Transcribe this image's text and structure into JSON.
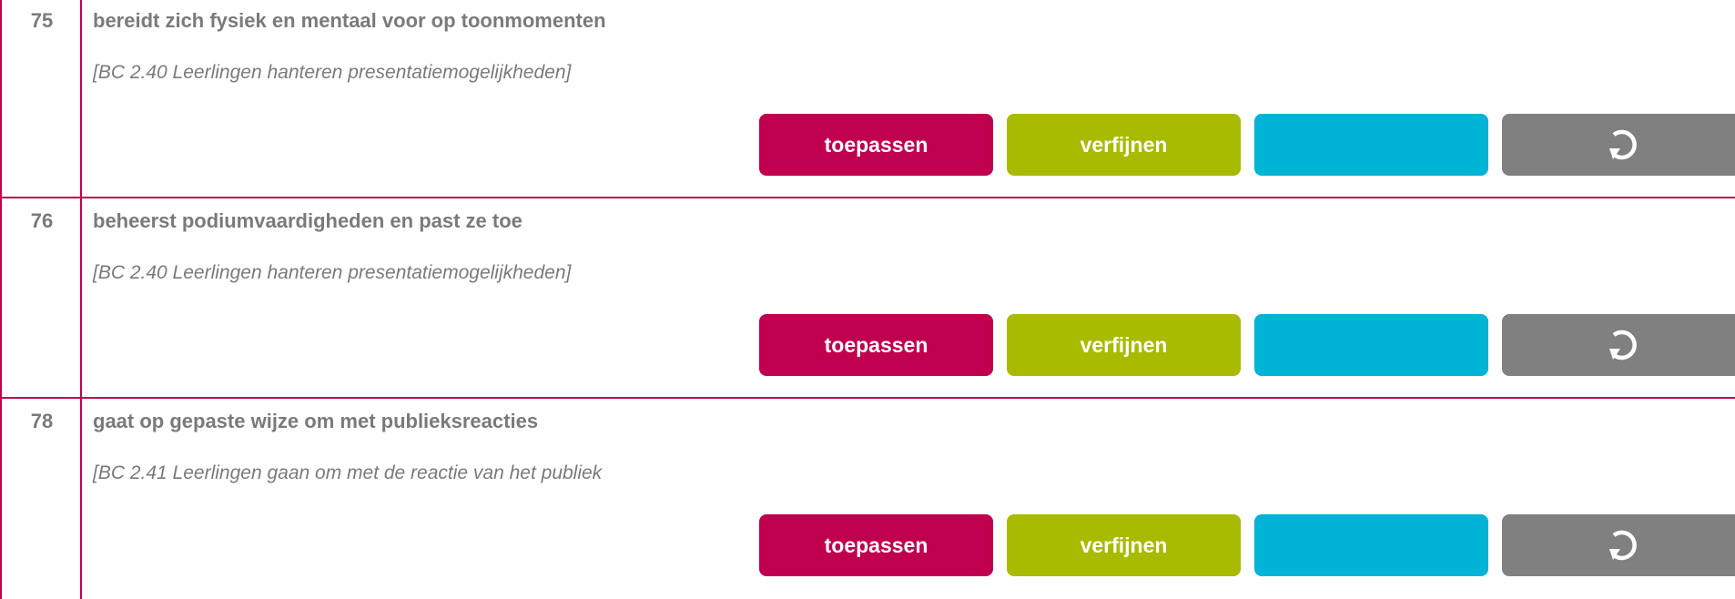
{
  "colors": {
    "border": "#c0004e",
    "apply": "#c0004e",
    "refine": "#a8bb00",
    "blank": "#00b4d6",
    "reset": "#808080",
    "text": "#7a7a7a"
  },
  "rows": [
    {
      "number": "75",
      "title": "bereidt zich fysiek en mentaal voor op toonmomenten",
      "reference": "[BC 2.40 Leerlingen hanteren presentatiemogelijkheden]",
      "apply_label": "toepassen",
      "refine_label": "verfijnen",
      "reset_icon": "refresh-icon"
    },
    {
      "number": "76",
      "title": "beheerst podiumvaardigheden en past ze toe",
      "reference": "[BC 2.40 Leerlingen hanteren presentatiemogelijkheden]",
      "apply_label": "toepassen",
      "refine_label": "verfijnen",
      "reset_icon": "refresh-icon"
    },
    {
      "number": "78",
      "title": "gaat op gepaste wijze om met publieksreacties",
      "reference": "[BC 2.41 Leerlingen gaan om met de reactie van het publiek",
      "apply_label": "toepassen",
      "refine_label": "verfijnen",
      "reset_icon": "refresh-icon"
    }
  ]
}
